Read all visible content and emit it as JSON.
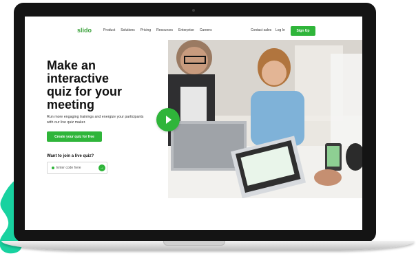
{
  "nav": {
    "logo": "slido",
    "links": [
      "Product",
      "Solutions",
      "Pricing",
      "Resources",
      "Enterprise",
      "Careers"
    ],
    "contact": "Contact sales",
    "login": "Log In",
    "signup": "Sign Up"
  },
  "hero": {
    "title_lines": [
      "Make an",
      "interactive",
      "quiz for your",
      "meeting"
    ],
    "subtitle": "Run more engaging trainings and energize your participants with our live quiz maker.",
    "cta": "Create your quiz for free",
    "join_label": "Want to join a live quiz?",
    "code_placeholder": "Enter code here"
  },
  "icons": {
    "play": "play-icon",
    "arrow": "arrow-right-icon",
    "code_marker": "hash-icon"
  },
  "colors": {
    "accent": "#2fb53a",
    "splash": "#18d2a0",
    "text": "#111111"
  }
}
